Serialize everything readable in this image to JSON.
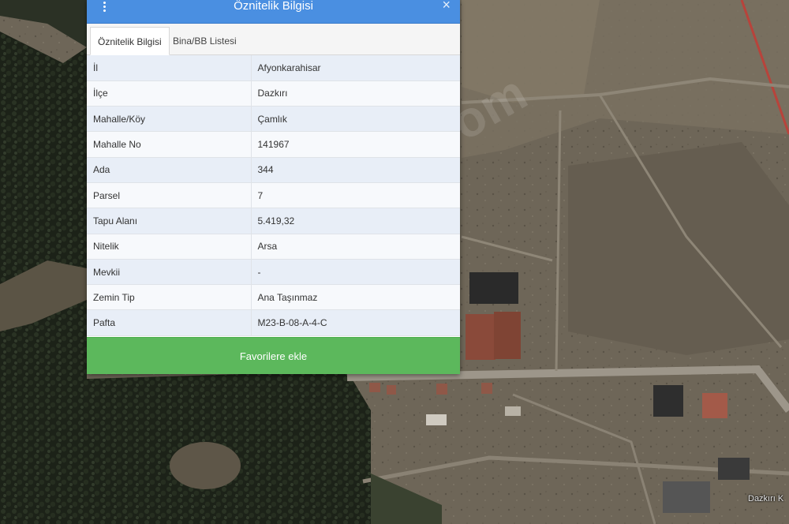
{
  "panel": {
    "title": "Öznitelik Bilgisi",
    "close_symbol": "×",
    "tabs": [
      {
        "label": "Öznitelik Bilgisi",
        "active": true
      },
      {
        "label": "Bina/BB Listesi",
        "active": false
      }
    ],
    "rows": [
      {
        "key": "İl",
        "value": "Afyonkarahisar"
      },
      {
        "key": "İlçe",
        "value": "Dazkırı"
      },
      {
        "key": "Mahalle/Köy",
        "value": "Çamlık"
      },
      {
        "key": "Mahalle No",
        "value": "141967"
      },
      {
        "key": "Ada",
        "value": "344"
      },
      {
        "key": "Parsel",
        "value": "7"
      },
      {
        "key": "Tapu Alanı",
        "value": "5.419,32"
      },
      {
        "key": "Nitelik",
        "value": "Arsa"
      },
      {
        "key": "Mevkii",
        "value": "-"
      },
      {
        "key": "Zemin Tip",
        "value": "Ana Taşınmaz"
      },
      {
        "key": "Pafta",
        "value": "M23-B-08-A-4-C"
      }
    ],
    "favorite_label": "Favorilere ekle"
  },
  "map": {
    "place_label": "Dazkırı K",
    "watermark": "sahibinden.com"
  },
  "colors": {
    "header": "#4a8fe1",
    "favorite_button": "#5cb85c",
    "row_odd": "#e8eef7",
    "row_even": "#f7f9fc"
  },
  "icons": {
    "menu": "vertical-ellipsis-icon",
    "close": "close-icon"
  }
}
